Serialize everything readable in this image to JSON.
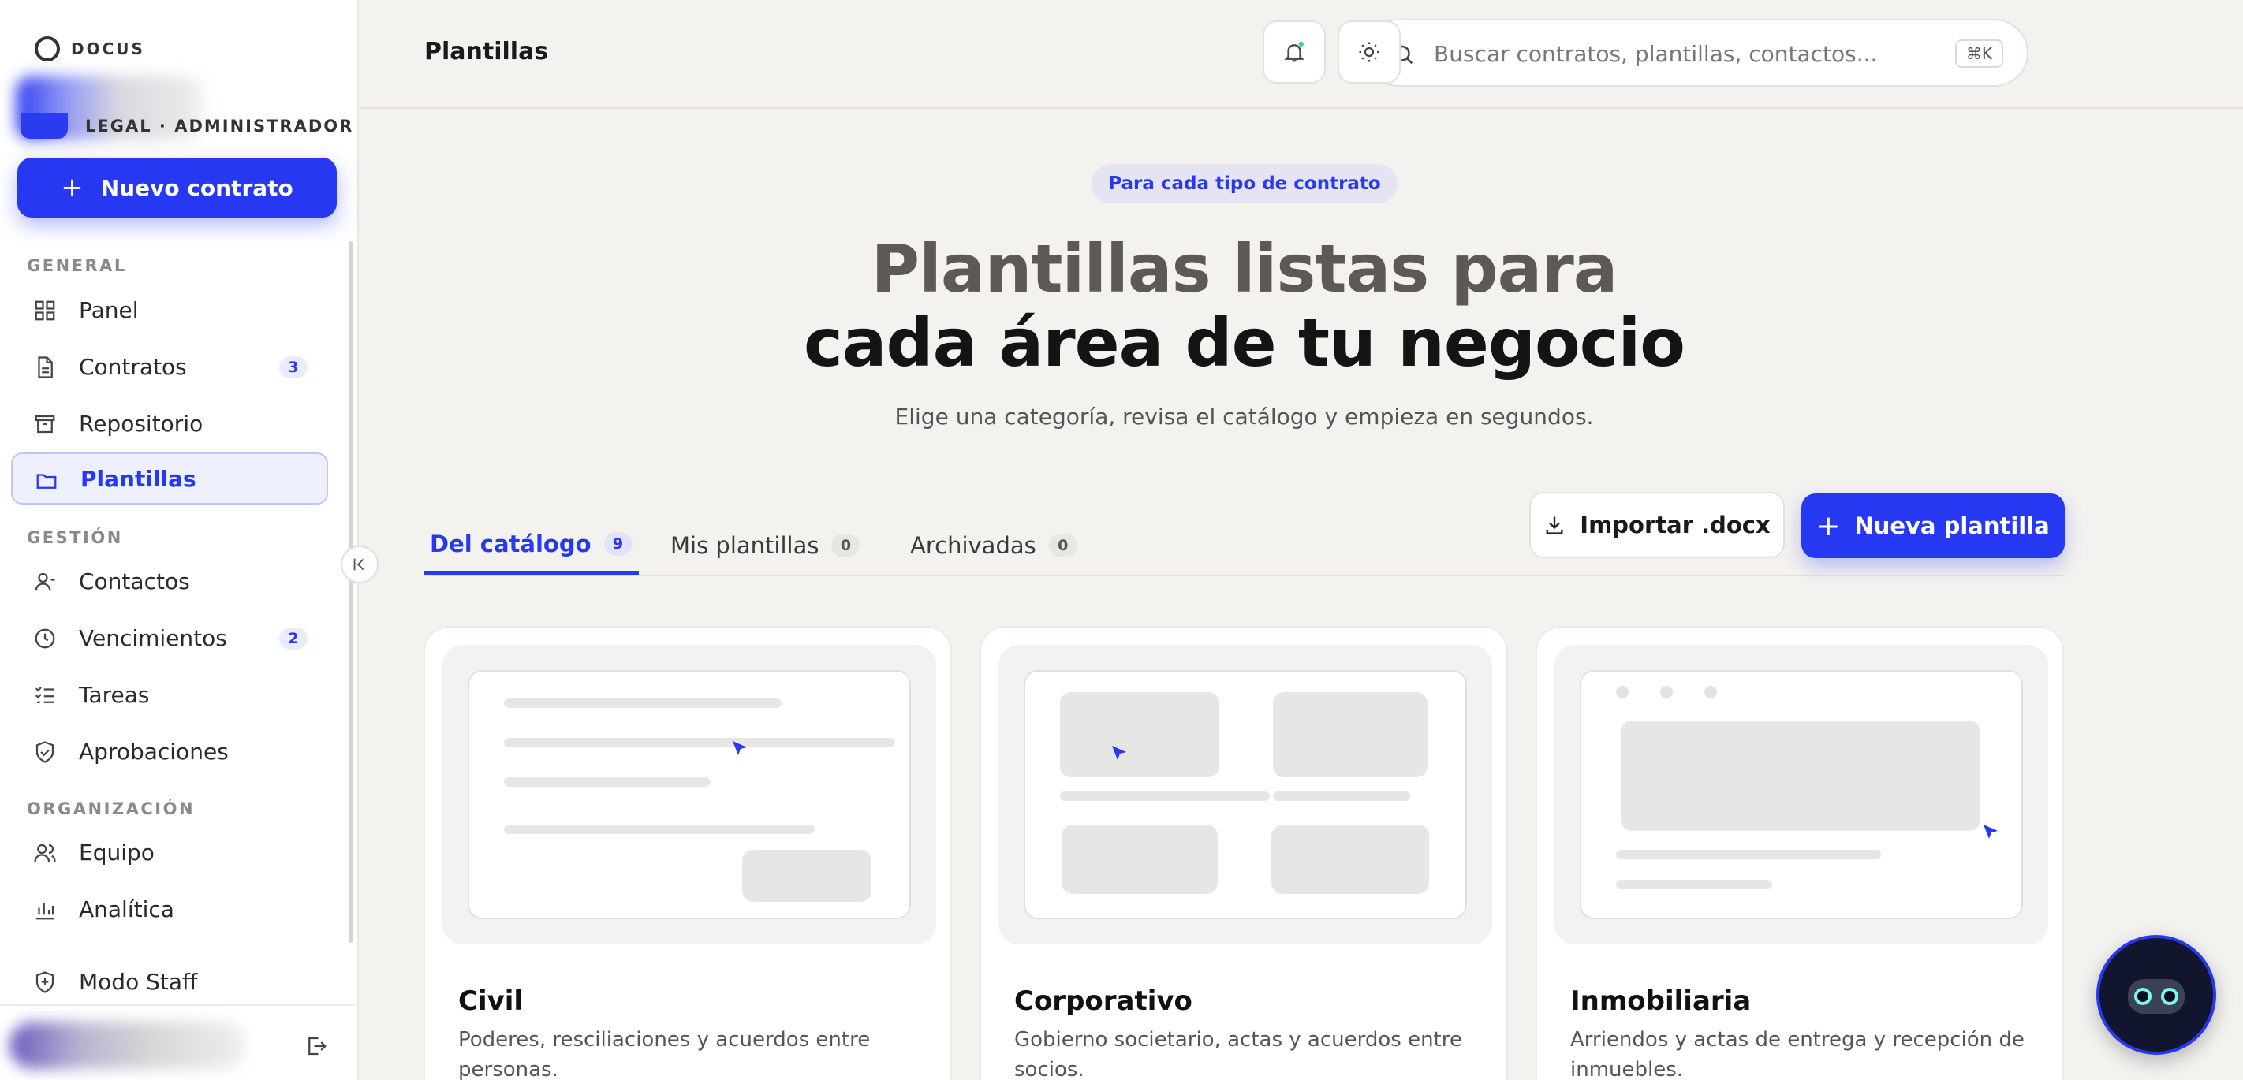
{
  "sidebar": {
    "brand": "DOCUS",
    "org_role": "LEGAL · ADMINISTRADOR",
    "new_contract_label": "Nuevo contrato",
    "sections": {
      "general": "GENERAL",
      "gestion": "GESTIÓN",
      "organizacion": "ORGANIZACIÓN"
    },
    "items": [
      {
        "label": "Panel",
        "icon": "grid-icon"
      },
      {
        "label": "Contratos",
        "icon": "document-icon",
        "badge": "3"
      },
      {
        "label": "Repositorio",
        "icon": "archive-icon"
      },
      {
        "label": "Plantillas",
        "icon": "folder-icon",
        "active": true
      },
      {
        "label": "Contactos",
        "icon": "user-icon"
      },
      {
        "label": "Vencimientos",
        "icon": "clock-icon",
        "badge": "2"
      },
      {
        "label": "Tareas",
        "icon": "checklist-icon"
      },
      {
        "label": "Aprobaciones",
        "icon": "shield-check-icon"
      },
      {
        "label": "Equipo",
        "icon": "users-icon"
      },
      {
        "label": "Analítica",
        "icon": "bar-chart-icon"
      },
      {
        "label": "Modo Staff",
        "icon": "shield-plus-icon"
      }
    ]
  },
  "topbar": {
    "title": "Plantillas",
    "search_placeholder": "Buscar contratos, plantillas, contactos...",
    "search_shortcut": "⌘K"
  },
  "hero": {
    "pill": "Para cada tipo de contrato",
    "title_line1": "Plantillas listas para",
    "title_line2": "cada área de tu negocio",
    "subtitle": "Elige una categoría, revisa el catálogo y empieza en segundos."
  },
  "tabs": [
    {
      "label": "Del catálogo",
      "count": "9",
      "active": true
    },
    {
      "label": "Mis plantillas",
      "count": "0"
    },
    {
      "label": "Archivadas",
      "count": "0"
    }
  ],
  "actions": {
    "import_label": "Importar .docx",
    "new_label": "Nueva plantilla"
  },
  "cards": [
    {
      "title": "Civil",
      "description": "Poderes, resciliaciones y acuerdos entre personas."
    },
    {
      "title": "Corporativo",
      "description": "Gobierno societario, actas y acuerdos entre socios."
    },
    {
      "title": "Inmobiliaria",
      "description": "Arriendos y actas de entrega y recepción de inmuebles."
    }
  ],
  "colors": {
    "accent": "#2638f2",
    "background": "#f4f2ef",
    "notification_dot": "#3bd18a"
  }
}
